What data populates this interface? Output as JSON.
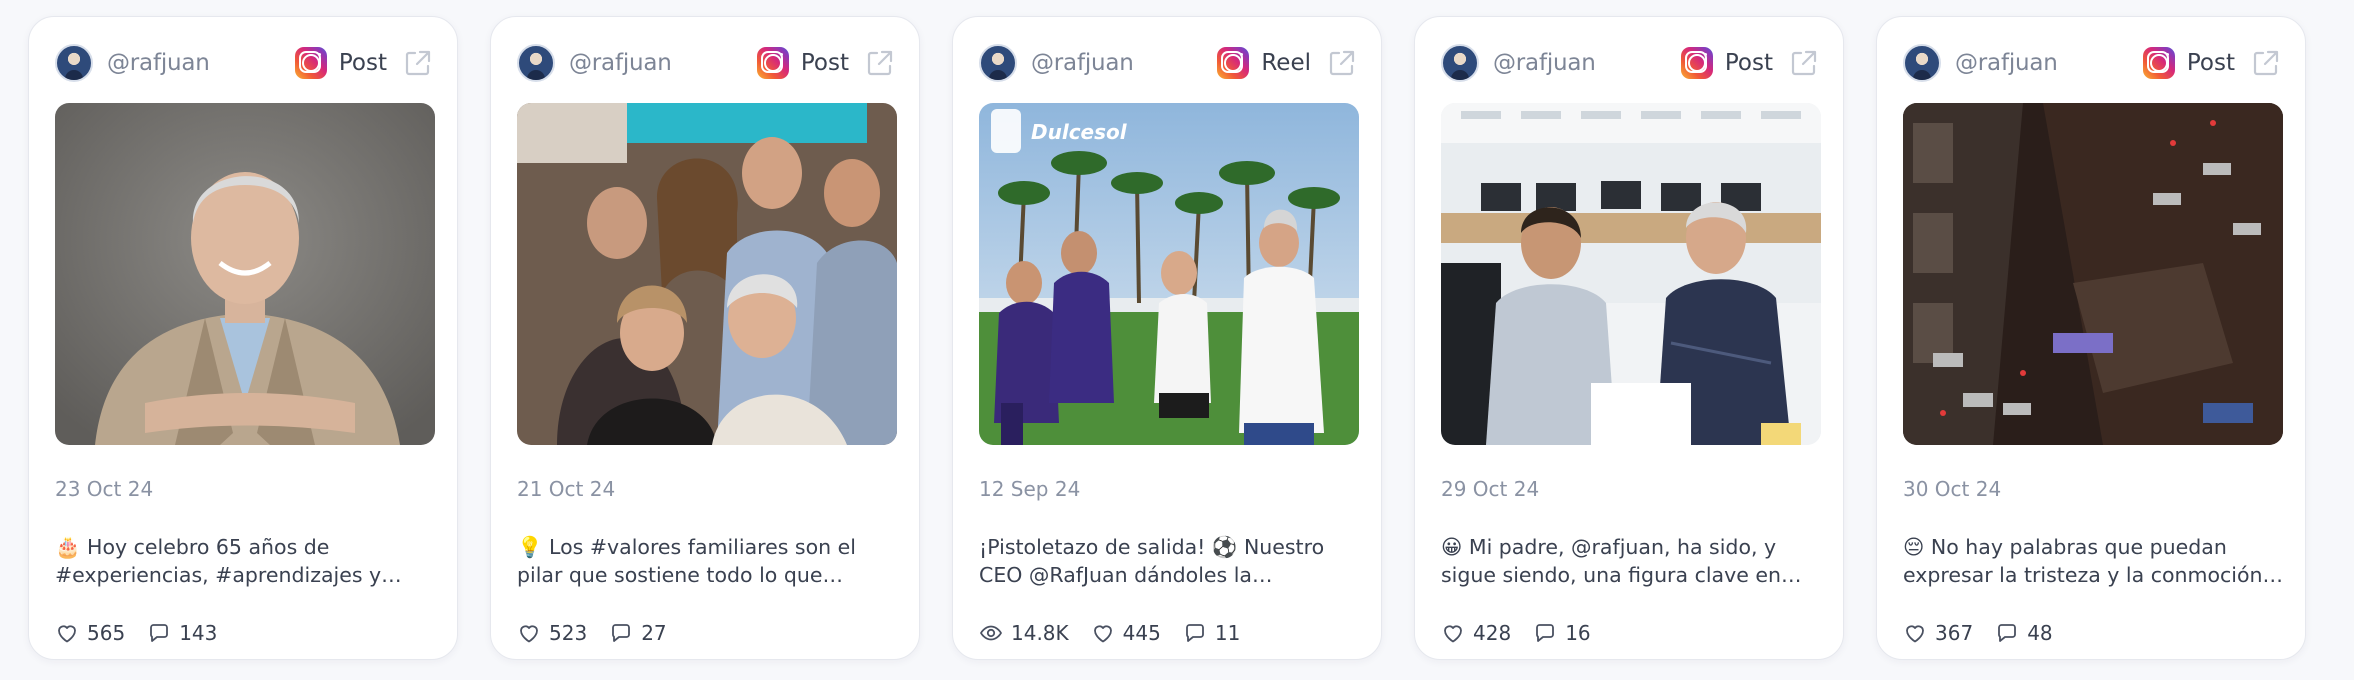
{
  "posts": [
    {
      "handle": "@rafjuan",
      "type": "Post",
      "date": "23 Oct 24",
      "caption": "🎂 Hoy celebro 65 años de #experiencias, #aprendizajes y…",
      "views": null,
      "likes": "565",
      "comments": "143"
    },
    {
      "handle": "@rafjuan",
      "type": "Post",
      "date": "21 Oct 24",
      "caption": "💡 Los #valores familiares son el pilar que sostiene todo lo que hacemos. Mis…",
      "views": null,
      "likes": "523",
      "comments": "27"
    },
    {
      "handle": "@rafjuan",
      "type": "Reel",
      "date": "12 Sep 24",
      "caption": "¡Pistoletazo de salida! ⚽ Nuestro CEO @RafJuan dándoles la bienvenida y…",
      "views": "14.8K",
      "likes": "445",
      "comments": "11",
      "overlay_text": "Dulcesol"
    },
    {
      "handle": "@rafjuan",
      "type": "Post",
      "date": "29 Oct 24",
      "caption": "😀 Mi padre, @rafjuan, ha sido, y sigue siendo, una figura clave en nuestras…",
      "views": null,
      "likes": "428",
      "comments": "16"
    },
    {
      "handle": "@rafjuan",
      "type": "Post",
      "date": "30 Oct 24",
      "caption": "😔 No hay palabras que puedan expresar la tristeza y la conmoción que…",
      "views": null,
      "likes": "367",
      "comments": "48"
    }
  ],
  "icons": {
    "platform": "instagram-icon",
    "external": "external-link-icon",
    "like": "heart-icon",
    "comment": "comment-icon",
    "views": "eye-icon"
  },
  "colors": {
    "card_bg": "#ffffff",
    "border": "#e6e8ee",
    "muted_text": "#8a92a3",
    "text": "#3a4150"
  }
}
